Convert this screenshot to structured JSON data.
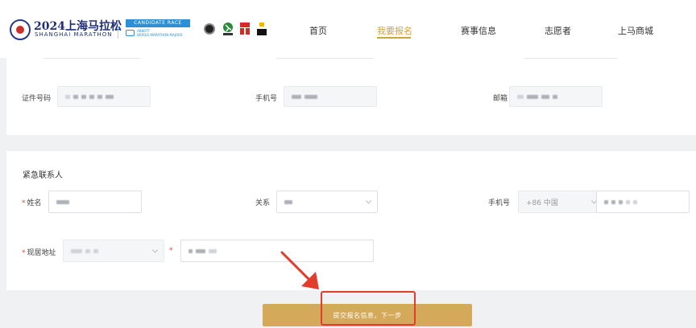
{
  "header": {
    "logo_main": "2024上海马拉松",
    "logo_sub": "SHANGHAI MARATHON",
    "candidate_label": "CANDIDATE RACE",
    "candidate_sub1": "ABBOTT",
    "candidate_sub2": "WORLD MARATHON MAJORS",
    "nav": [
      {
        "label": "首页"
      },
      {
        "label": "我要报名",
        "active": true
      },
      {
        "label": "赛事信息"
      },
      {
        "label": "志愿者"
      },
      {
        "label": "上马商城"
      }
    ],
    "accent_color": "#d4a23a"
  },
  "identity_section": {
    "id_number_label": "证件号码",
    "phone_label": "手机号",
    "email_label": "邮箱"
  },
  "emergency_section": {
    "title": "紧急联系人",
    "required_mark": "*",
    "name_label": "姓名",
    "relation_label": "关系",
    "phone_label": "手机号",
    "country_code": "+86 中国",
    "address_label": "现居地址"
  },
  "submit": {
    "label": "提交报名信息，下一步",
    "color": "#d4a95a",
    "highlight_color": "#e13c2c"
  }
}
